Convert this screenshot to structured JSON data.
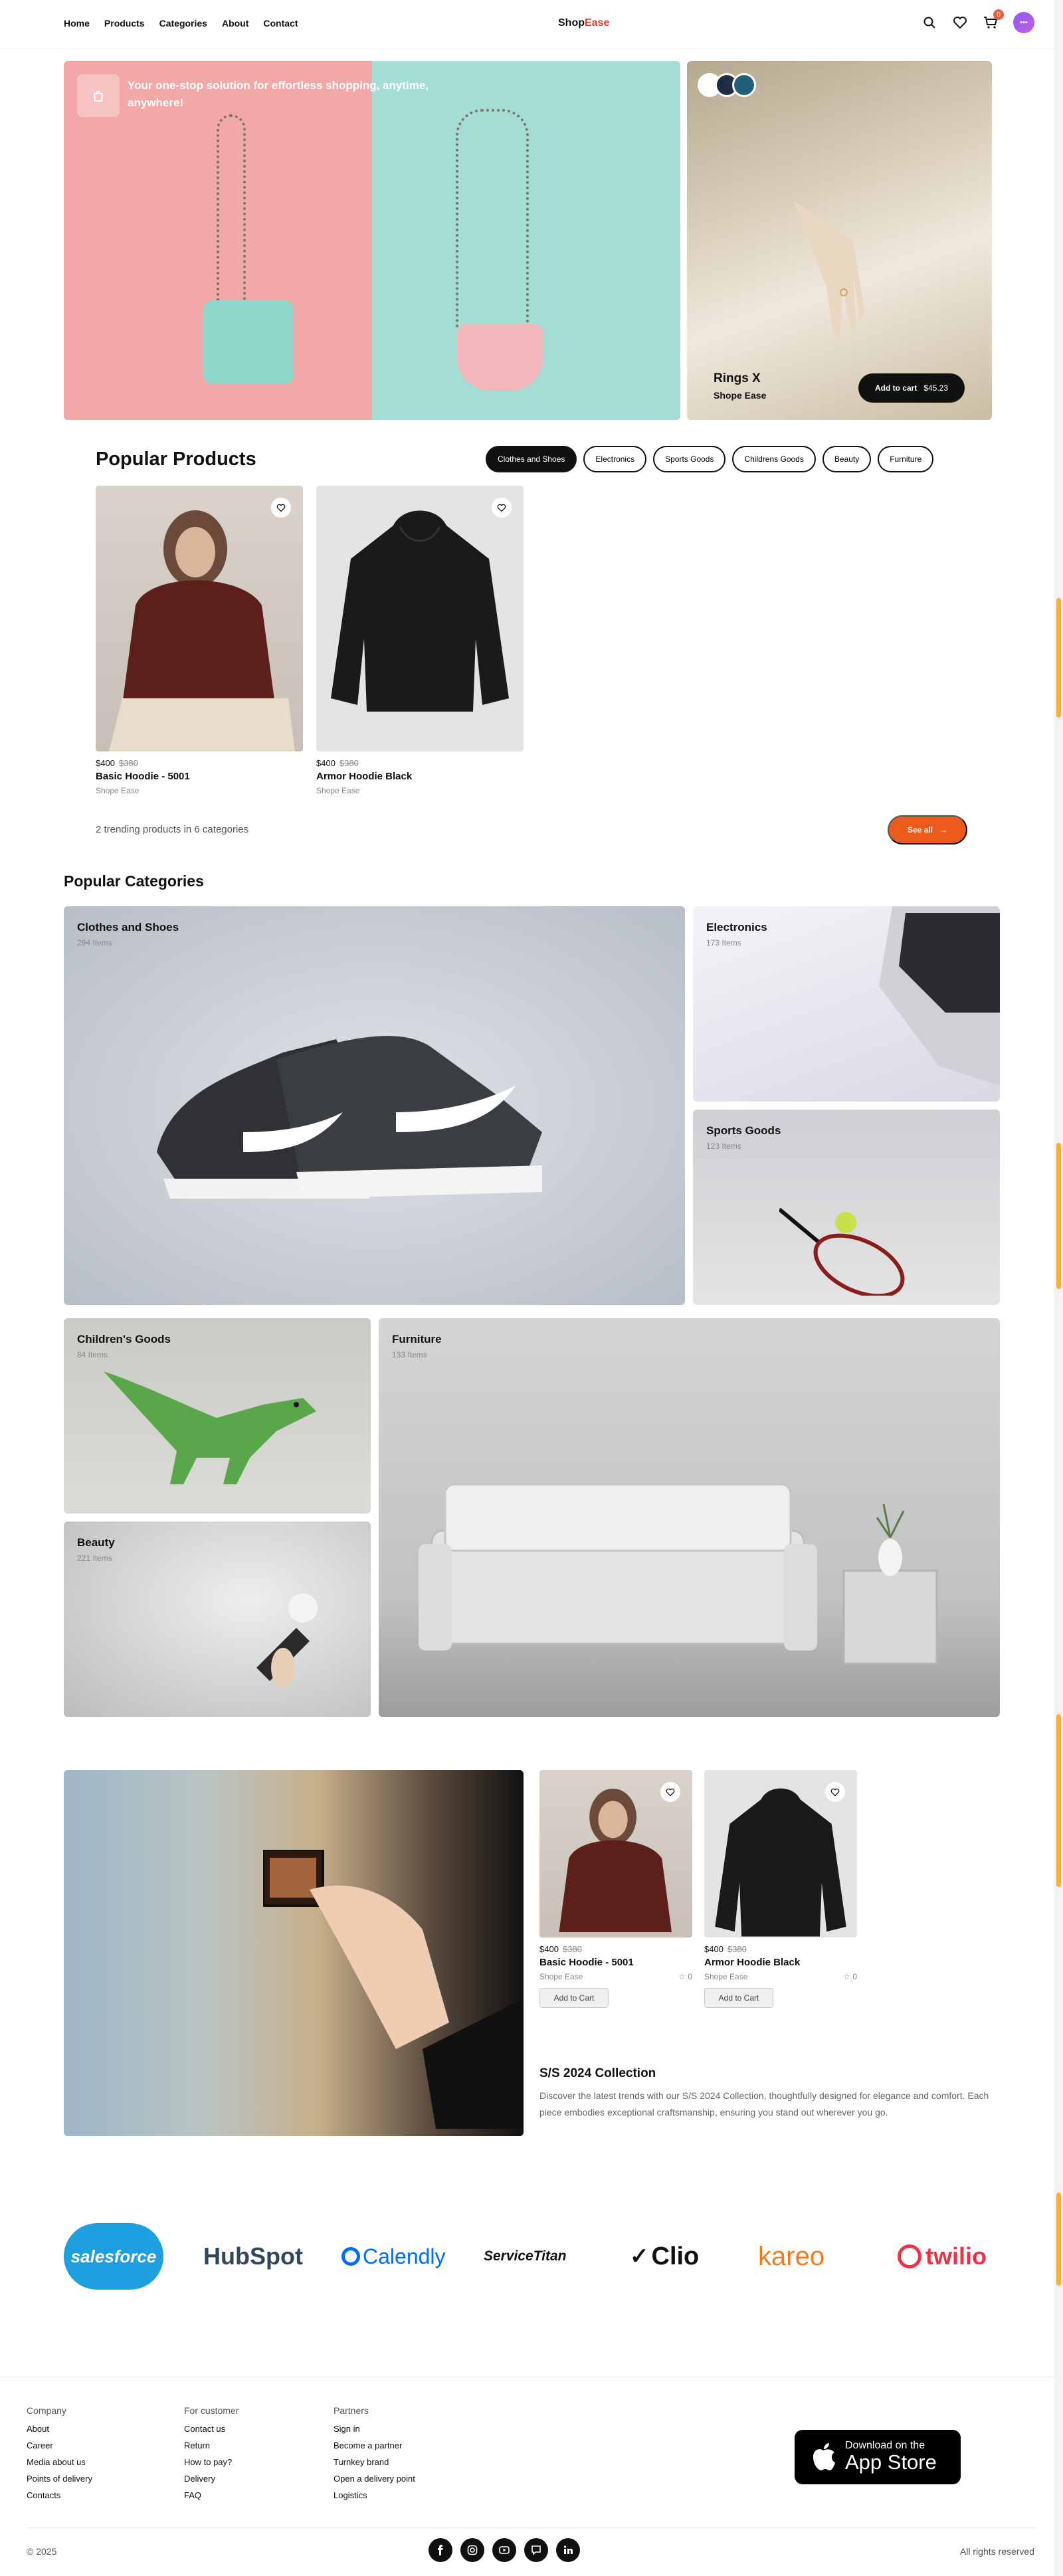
{
  "colors": {
    "accent": "#ec5a1c",
    "brand_red": "#e8372b",
    "dark": "#111111"
  },
  "header": {
    "nav": [
      "Home",
      "Products",
      "Categories",
      "About",
      "Contact"
    ],
    "logo_main": "Shop",
    "logo_accent": "Ease",
    "cart_count": "0",
    "icons": [
      "search-icon",
      "heart-icon",
      "cart-icon",
      "avatar"
    ]
  },
  "hero": {
    "tagline": "Your one-stop solution for effortless shopping, anytime, anywhere!",
    "side": {
      "name": "Rings X",
      "brand": "Shope Ease",
      "button": "Add to cart",
      "price": "$45.23",
      "swatches": [
        "#ffffff",
        "#1e2c44",
        "#1f5f78"
      ]
    }
  },
  "popular_products": {
    "title": "Popular Products",
    "filters": [
      "Clothes and Shoes",
      "Electronics",
      "Sports Goods",
      "Childrens Goods",
      "Beauty",
      "Furniture"
    ],
    "active_filter": "Clothes and Shoes",
    "items": [
      {
        "price": "$400",
        "old_price": "$380",
        "name": "Basic Hoodie - 5001",
        "brand": "Shope Ease"
      },
      {
        "price": "$400",
        "old_price": "$380",
        "name": "Armor Hoodie Black",
        "brand": "Shope Ease"
      }
    ],
    "summary": "2 trending products in 6 categories",
    "see_all": "See all"
  },
  "popular_categories": {
    "title": "Popular Categories",
    "items": [
      {
        "name": "Clothes and Shoes",
        "count": "294 Items"
      },
      {
        "name": "Electronics",
        "count": "173 Items"
      },
      {
        "name": "Sports Goods",
        "count": "123 Items"
      },
      {
        "name": "Children's Goods",
        "count": "84 Items"
      },
      {
        "name": "Furniture",
        "count": "133 Items"
      },
      {
        "name": "Beauty",
        "count": "221 Items"
      }
    ]
  },
  "collection": {
    "items": [
      {
        "price": "$400",
        "old_price": "$380",
        "name": "Basic Hoodie - 5001",
        "brand": "Shope Ease",
        "rating": "0",
        "button": "Add to Cart"
      },
      {
        "price": "$400",
        "old_price": "$380",
        "name": "Armor Hoodie Black",
        "brand": "Shope Ease",
        "rating": "0",
        "button": "Add to Cart"
      }
    ],
    "title": "S/S 2024 Collection",
    "description": "Discover the latest trends with our S/S 2024 Collection, thoughtfully designed for elegance and comfort. Each piece embodies exceptional craftsmanship, ensuring you stand out wherever you go."
  },
  "partner_logos": [
    "salesforce",
    "HubSpot",
    "Calendly",
    "ServiceTitan",
    "Clio",
    "kareo",
    "twilio"
  ],
  "partner_logo_colors": [
    "#1ea0e0",
    "#33475b",
    "#006bff",
    "#111111",
    "#111111",
    "#f47a1f",
    "#f22f46"
  ],
  "footer": {
    "columns": [
      {
        "title": "Company",
        "links": [
          "About",
          "Career",
          "Media about us",
          "Points of delivery",
          "Contacts"
        ]
      },
      {
        "title": "For customer",
        "links": [
          "Contact us",
          "Return",
          "How to pay?",
          "Delivery",
          "FAQ"
        ]
      },
      {
        "title": "Partners",
        "links": [
          "Sign in",
          "Become a partner",
          "Turnkey brand",
          "Open a delivery point",
          "Logistics"
        ]
      }
    ],
    "app_store_line1": "Download on the",
    "app_store_line2": "App Store",
    "copyright": "© 2025",
    "rights": "All rights reserved",
    "socials": [
      "facebook-icon",
      "instagram-icon",
      "youtube-icon",
      "chat-icon",
      "linkedin-icon"
    ]
  }
}
